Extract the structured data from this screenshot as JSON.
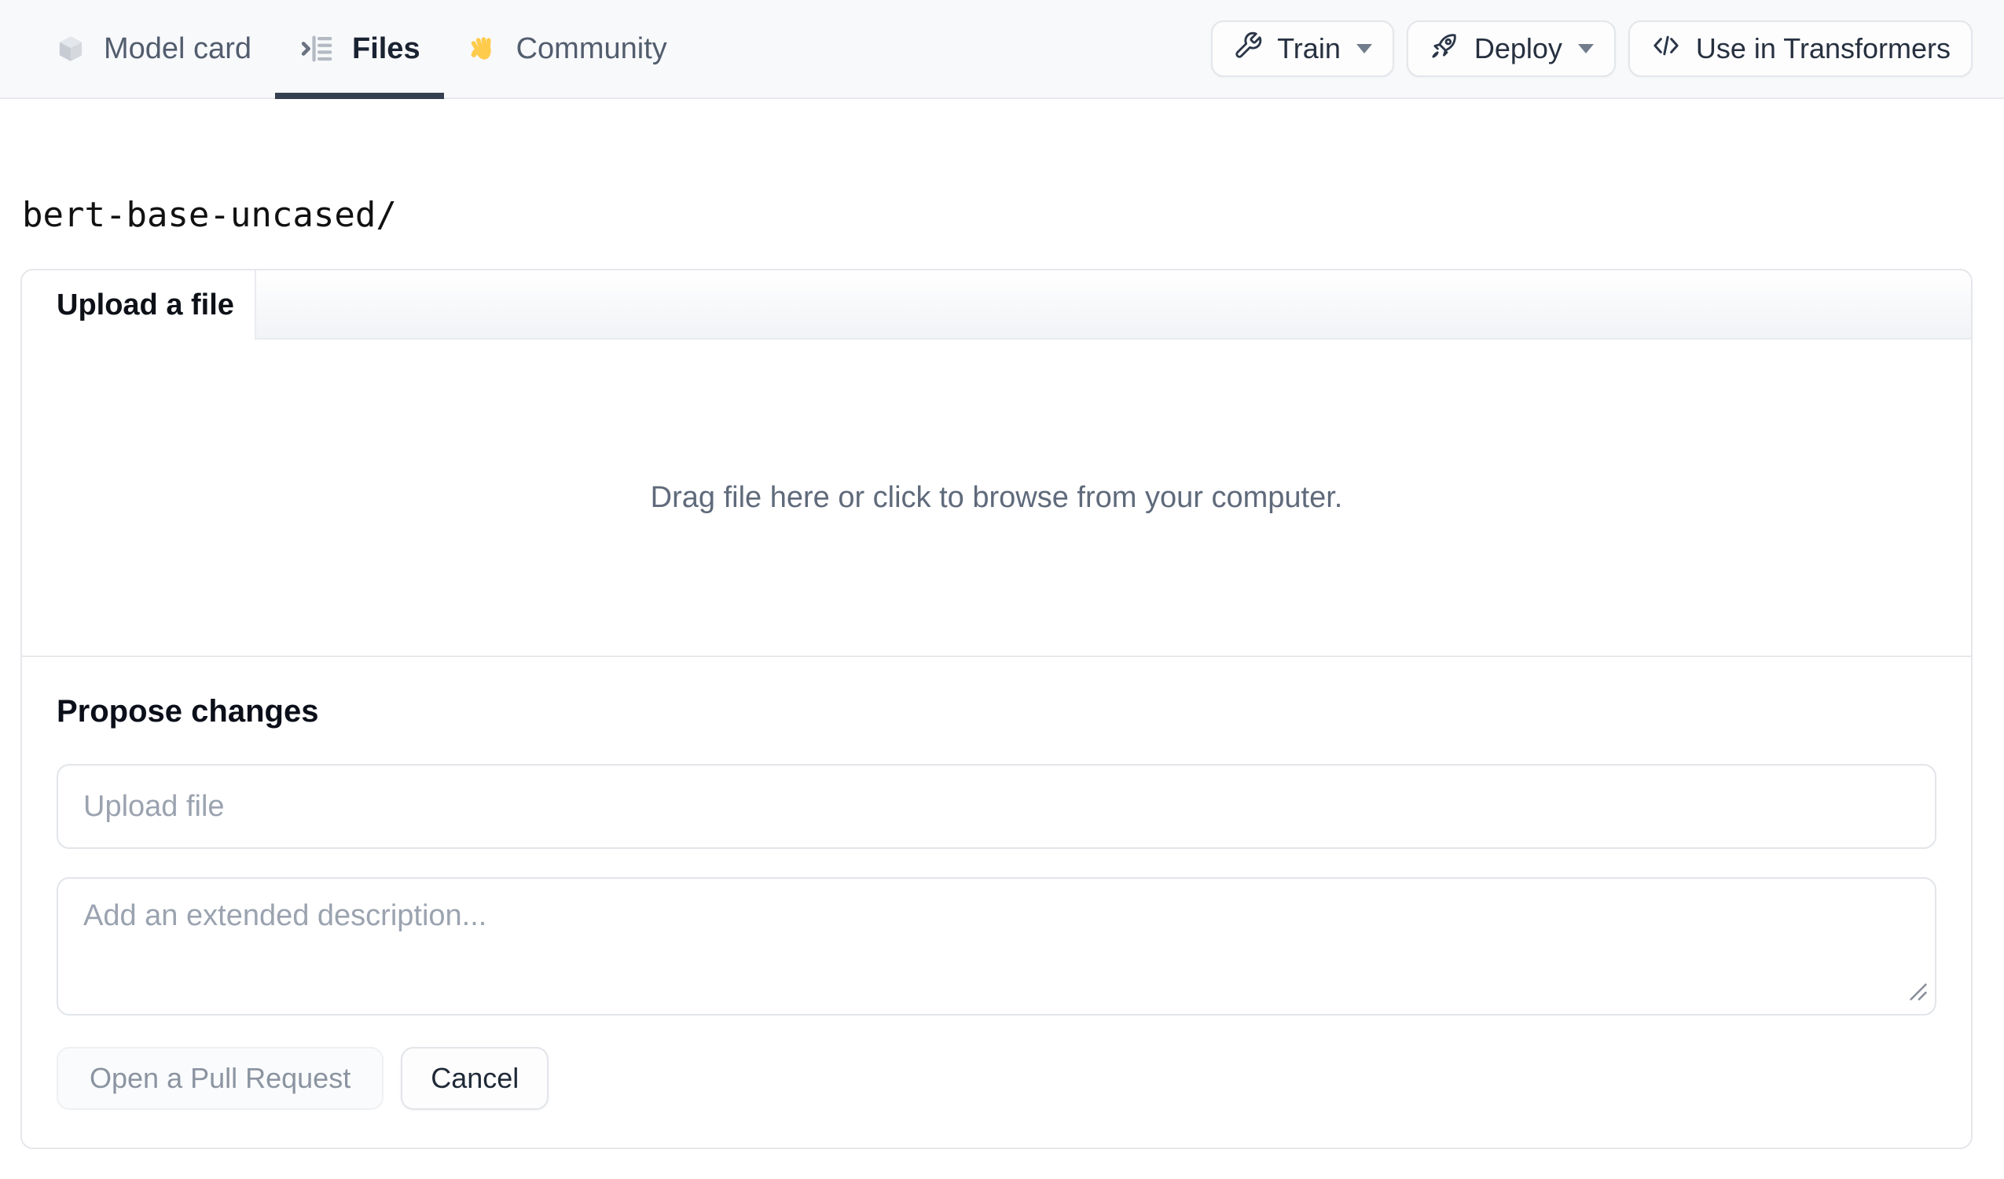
{
  "nav": {
    "tabs": [
      {
        "label": "Model card",
        "icon": "cube-icon",
        "active": false
      },
      {
        "label": "Files",
        "icon": "files-list-icon",
        "active": true
      },
      {
        "label": "Community",
        "icon": "wave-emoji-icon",
        "active": false
      }
    ],
    "actions": {
      "train_label": "Train",
      "train_icon": "wrench-icon",
      "deploy_label": "Deploy",
      "deploy_icon": "rocket-icon",
      "use_in_transformers_label": "Use in Transformers",
      "use_in_transformers_icon": "code-icon",
      "dropdown_icon": "caret-down-icon"
    }
  },
  "breadcrumb": {
    "path": "bert-base-uncased/"
  },
  "upload_card": {
    "tab_title": "Upload a file",
    "dropzone_text": "Drag file here or click to browse from your computer.",
    "propose": {
      "heading": "Propose changes",
      "filename_placeholder": "Upload file",
      "description_placeholder": "Add an extended description...",
      "open_pr_label": "Open a Pull Request",
      "open_pr_state": "disabled",
      "cancel_label": "Cancel",
      "resize_icon": "resize-handle-icon"
    }
  },
  "colors": {
    "nav_bg": "#f8f9fb",
    "nav_border": "#e8eaee",
    "tab_text": "#525d6e",
    "tab_active_text": "#1a2332",
    "tab_active_underline": "#354050",
    "button_bg": "#fdfdfe",
    "button_border": "#e3e6ea",
    "button_text": "#26303f",
    "card_border": "#e5e7eb",
    "card_header_gradient_top": "#ffffff",
    "card_header_gradient_bottom": "#f1f3f6",
    "dropzone_text": "#5f6a7b",
    "placeholder_text": "#9ba3b0",
    "input_border": "#e2e5e9",
    "open_pr_text": "#8b94a1",
    "open_pr_bg": "#fafbfc",
    "cancel_text": "#1f2937",
    "emoji_yellow": "#ffcb4c"
  }
}
